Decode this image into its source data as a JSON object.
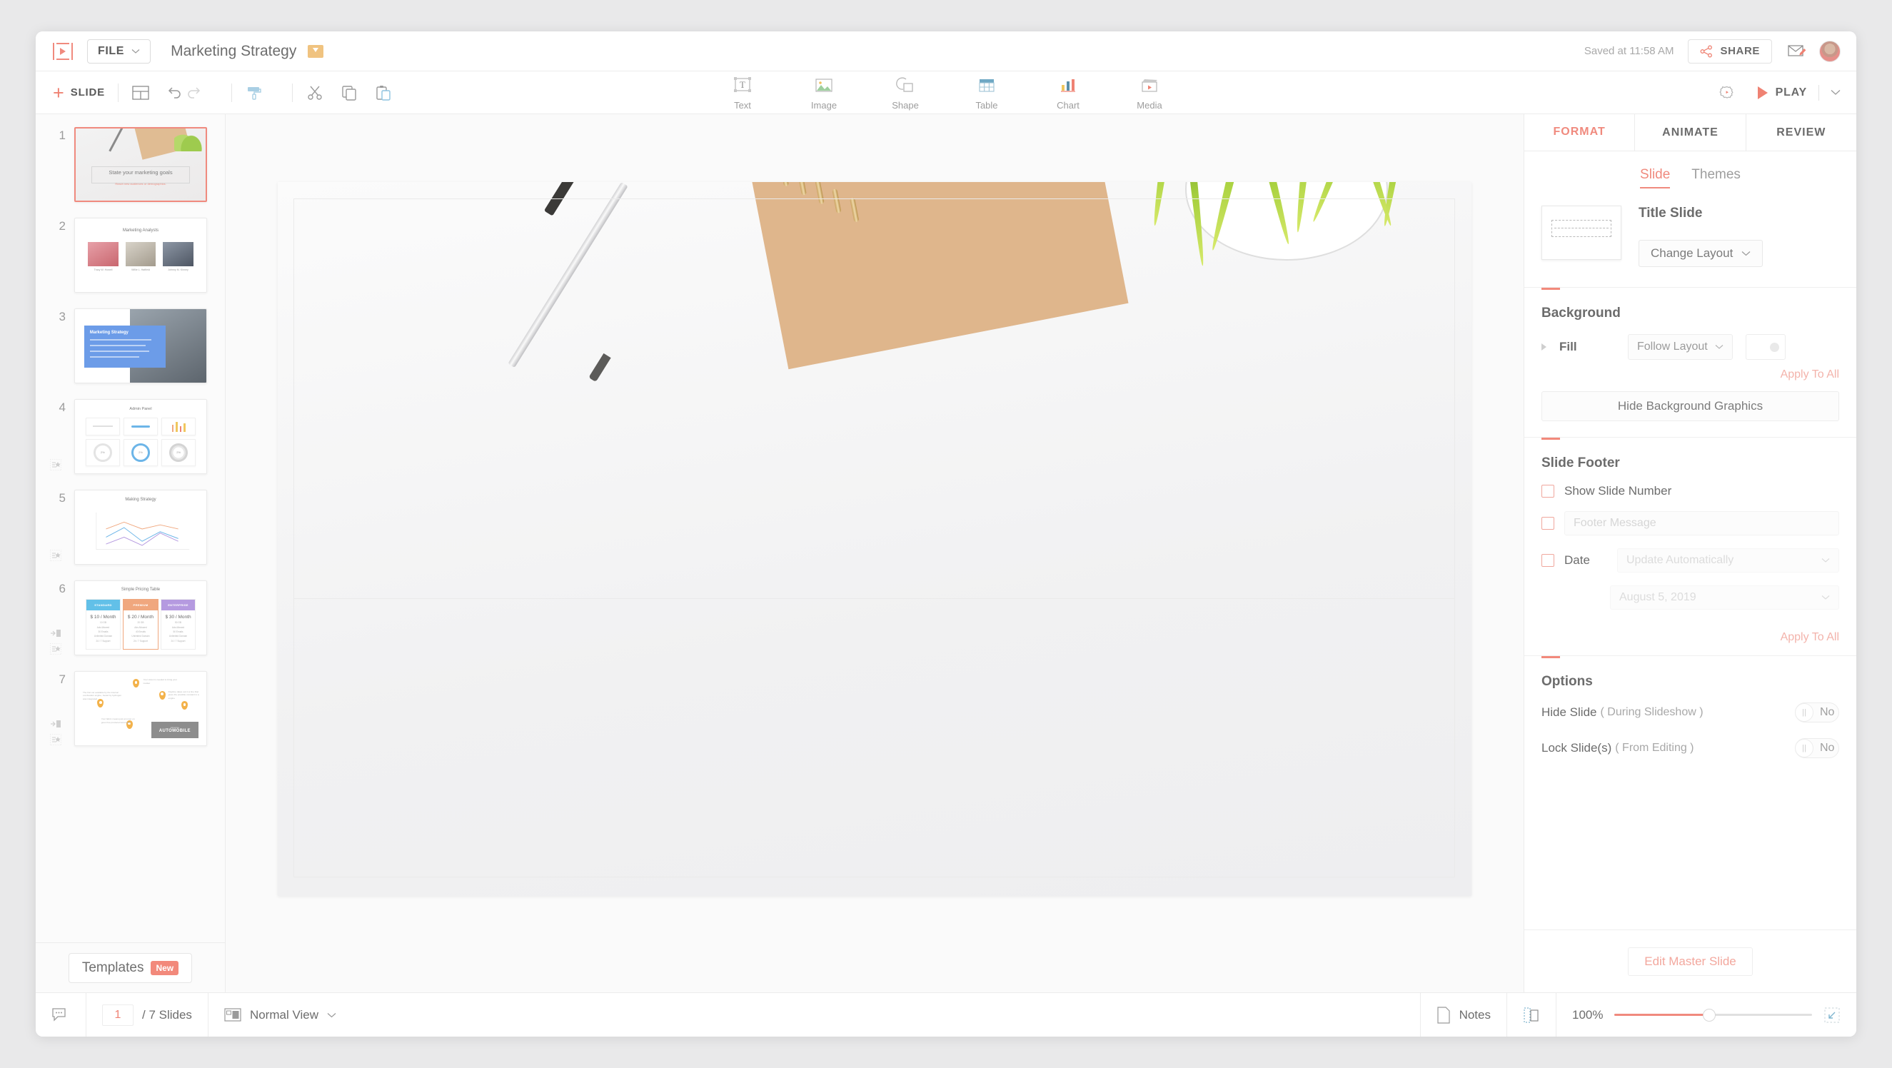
{
  "header": {
    "logo": "zoho-show-logo",
    "file_menu": "FILE",
    "document_title": "Marketing Strategy",
    "folder_icon": "folder-move-icon",
    "saved_status": "Saved at 11:58 AM",
    "share_label": "SHARE",
    "share_icon": "share-icon",
    "annotate_icon": "annotate-icon",
    "avatar": "user-avatar"
  },
  "toolbar": {
    "add_slide_label": "SLIDE",
    "add_slide_plus": "+",
    "layout_icon": "slide-layout-icon",
    "undo_icon": "undo-icon",
    "redo_icon": "redo-icon",
    "format_painter_icon": "format-painter-icon",
    "cut_icon": "scissors-icon",
    "copy_icon": "copy-icon",
    "paste_icon": "paste-icon",
    "insert_items": [
      {
        "label": "Text",
        "icon": "text-box-icon"
      },
      {
        "label": "Image",
        "icon": "image-icon"
      },
      {
        "label": "Shape",
        "icon": "shape-icon"
      },
      {
        "label": "Table",
        "icon": "table-icon"
      },
      {
        "label": "Chart",
        "icon": "bar-chart-icon"
      },
      {
        "label": "Media",
        "icon": "clapperboard-icon"
      }
    ],
    "settings_icon": "gear-icon",
    "play_label": "PLAY",
    "play_icon": "play-triangle-icon",
    "play_dropdown_icon": "chevron-down-icon"
  },
  "sidebar": {
    "slides": [
      {
        "number": "1",
        "title": "State your marketing goals",
        "subtitle": "Reach new audiences or demographics.",
        "type": "title-photo"
      },
      {
        "number": "2",
        "title": "Marketing Analysts",
        "names": [
          "Tracy W. Howell",
          "Willie L. Hatfield",
          "Johnny M. Kinney"
        ],
        "type": "team"
      },
      {
        "number": "3",
        "title": "Marketing Strategy",
        "type": "card-photo"
      },
      {
        "number": "4",
        "title": "Admin Panel",
        "cards": [
          "Last Month Activity",
          "Current Activity",
          "Activity Range"
        ],
        "type": "dashboard"
      },
      {
        "number": "5",
        "title": "Making Strategy",
        "type": "line-chart"
      },
      {
        "number": "6",
        "title": "Simple Pricing Table",
        "tiers": [
          {
            "name": "STANDARD",
            "price": "$ 10 / Month",
            "color": "#62c0e8"
          },
          {
            "name": "PREMIUM",
            "price": "$ 20 / Month",
            "color": "#f0a77e"
          },
          {
            "name": "ENTERPRISE",
            "price": "$ 30 / Month",
            "color": "#b59ae0"
          }
        ],
        "type": "pricing"
      },
      {
        "number": "7",
        "title": "AUTOMOBILE",
        "subtitle": "Advertise",
        "type": "map-pins"
      }
    ],
    "templates_label": "Templates",
    "templates_badge": "New"
  },
  "canvas": {
    "description": "Title slide with pen, spiral notebook and potted plant photo background"
  },
  "right_panel": {
    "tabs": [
      {
        "label": "FORMAT",
        "active": true
      },
      {
        "label": "ANIMATE",
        "active": false
      },
      {
        "label": "REVIEW",
        "active": false
      }
    ],
    "subtabs": [
      {
        "label": "Slide",
        "active": true
      },
      {
        "label": "Themes",
        "active": false
      }
    ],
    "layout": {
      "name": "Title Slide",
      "change_layout_label": "Change Layout",
      "chevron_icon": "chevron-down-icon"
    },
    "background": {
      "title": "Background",
      "fill_label": "Fill",
      "fill_value": "Follow Layout",
      "apply_to_all": "Apply To All",
      "hide_graphics_label": "Hide Background Graphics",
      "expand_icon": "triangle-right-icon"
    },
    "slide_footer": {
      "title": "Slide Footer",
      "show_slide_number": "Show Slide Number",
      "footer_message_placeholder": "Footer Message",
      "date_label": "Date",
      "date_mode": "Update Automatically",
      "date_value": "August 5, 2019",
      "apply_to_all": "Apply To All"
    },
    "options": {
      "title": "Options",
      "hide_slide_label": "Hide Slide",
      "hide_slide_sub": "( During Slideshow )",
      "hide_slide_value": "No",
      "lock_slide_label": "Lock Slide(s)",
      "lock_slide_sub": "( From Editing )",
      "lock_slide_value": "No"
    },
    "edit_master_label": "Edit Master Slide"
  },
  "statusbar": {
    "comment_icon": "comment-icon",
    "current_slide": "1",
    "slide_count": "/ 7 Slides",
    "view_mode": "Normal View",
    "view_icon": "normal-view-icon",
    "notes_label": "Notes",
    "notes_icon": "notes-page-icon",
    "panel_icon": "toggle-panel-icon",
    "zoom_level": "100%",
    "fit_icon": "fit-to-screen-icon"
  },
  "colors": {
    "accent": "#f08a7e",
    "text": "#6c6c6c",
    "muted": "#a0a0a0"
  }
}
